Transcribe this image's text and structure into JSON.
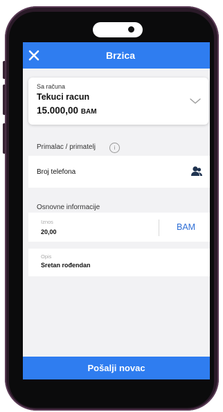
{
  "header": {
    "title": "Brzica",
    "close_icon": "close-icon"
  },
  "account": {
    "label": "Sa računa",
    "name": "Tekuci racun",
    "balance": "15.000,00",
    "currency": "BAM",
    "chevron_icon": "chevron-down-icon"
  },
  "recipient": {
    "section_label": "Primalac / primatelj",
    "info_icon": "i",
    "phone_label": "Broj telefona",
    "contact_icon": "contact-person-icon"
  },
  "basic_info": {
    "section_label": "Osnovne informacije",
    "amount_caption": "Iznos",
    "amount_value": "20,00",
    "amount_currency": "BAM",
    "description_caption": "Opis",
    "description_value": "Sretan rođendan"
  },
  "footer": {
    "send_label": "Pošalji novac"
  },
  "colors": {
    "accent": "#2f7df0",
    "background": "#f2f2f4",
    "frame": "#2a1a28"
  }
}
